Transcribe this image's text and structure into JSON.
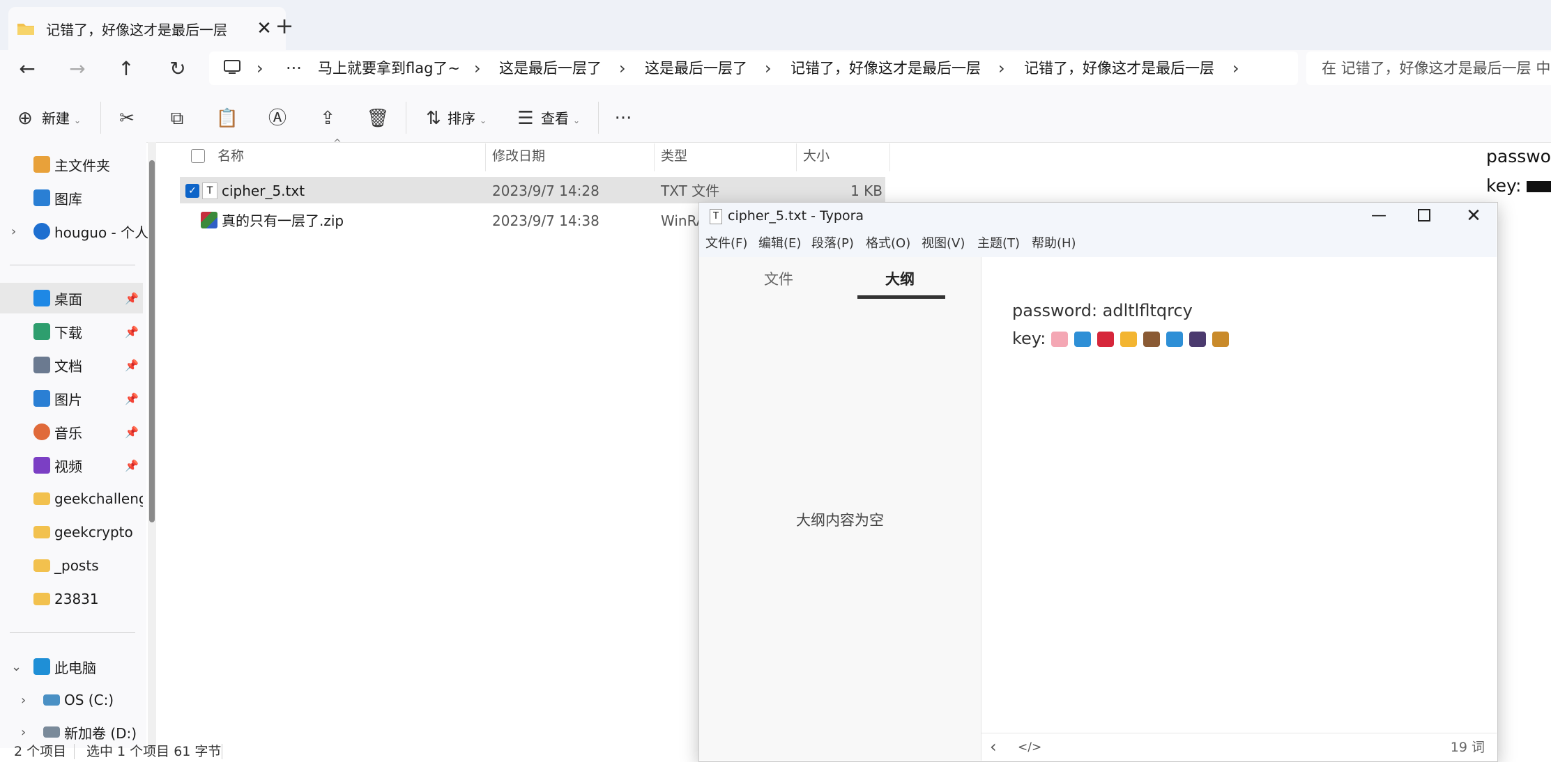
{
  "explorer": {
    "tab_title": "记错了，好像这才是最后一层",
    "breadcrumbs": [
      "马上就要拿到flag了~",
      "这是最后一层了",
      "这是最后一层了",
      "记错了，好像这才是最后一层",
      "记错了，好像这才是最后一层"
    ],
    "search_placeholder": "在 记错了，好像这才是最后一层 中",
    "toolbar": {
      "new_label": "新建",
      "sort_label": "排序",
      "view_label": "查看",
      "more": "···"
    },
    "sidebar": {
      "home": "主文件夹",
      "gallery": "图库",
      "onedrive": "houguo - 个人",
      "pinned": [
        {
          "label": "桌面",
          "color": "#1e88e5"
        },
        {
          "label": "下载",
          "color": "#2e9e6e"
        },
        {
          "label": "文档",
          "color": "#6b7a90"
        },
        {
          "label": "图片",
          "color": "#2a7fd4"
        },
        {
          "label": "音乐",
          "color": "#e06a3a"
        },
        {
          "label": "视频",
          "color": "#7b3fc4"
        }
      ],
      "folders": [
        "geekchallenge",
        "geekcrypto",
        "_posts",
        "23831"
      ],
      "this_pc": "此电脑",
      "drives": [
        "OS (C:)",
        "新加卷 (D:)"
      ]
    },
    "columns": {
      "name": "名称",
      "modified": "修改日期",
      "type": "类型",
      "size": "大小"
    },
    "files": [
      {
        "name": "cipher_5.txt",
        "modified": "2023/9/7 14:28",
        "type": "TXT 文件",
        "size": "1 KB"
      },
      {
        "name": "真的只有一层了.zip",
        "modified": "2023/9/7 14:38",
        "type": "WinRA"
      }
    ],
    "status": {
      "count": "2 个项目",
      "selection": "选中 1 个项目  61 字节"
    },
    "peek_lines": [
      "passwor",
      "key: "
    ]
  },
  "typora": {
    "title": "cipher_5.txt - Typora",
    "menu": [
      "文件(F)",
      "编辑(E)",
      "段落(P)",
      "格式(O)",
      "视图(V)",
      "主题(T)",
      "帮助(H)"
    ],
    "tabs": {
      "files": "文件",
      "outline": "大纲"
    },
    "outline_empty": "大纲内容为空",
    "password_line": "password: adltlfltqrcy",
    "key_label": "key:",
    "key_emojis": [
      {
        "name": "bikini-emoji",
        "color": "#f4a7b4"
      },
      {
        "name": "shirt-emoji",
        "color": "#2e8fd6"
      },
      {
        "name": "high-heel-emoji",
        "color": "#d6263a"
      },
      {
        "name": "person-emoji",
        "color": "#f3b531"
      },
      {
        "name": "shoe-emoji",
        "color": "#8a5a34"
      },
      {
        "name": "shirt-emoji-2",
        "color": "#2e8fd6"
      },
      {
        "name": "bust-emoji",
        "color": "#4b3a6e"
      },
      {
        "name": "handbag-emoji",
        "color": "#c98a2a"
      }
    ],
    "word_count": "19 词"
  }
}
